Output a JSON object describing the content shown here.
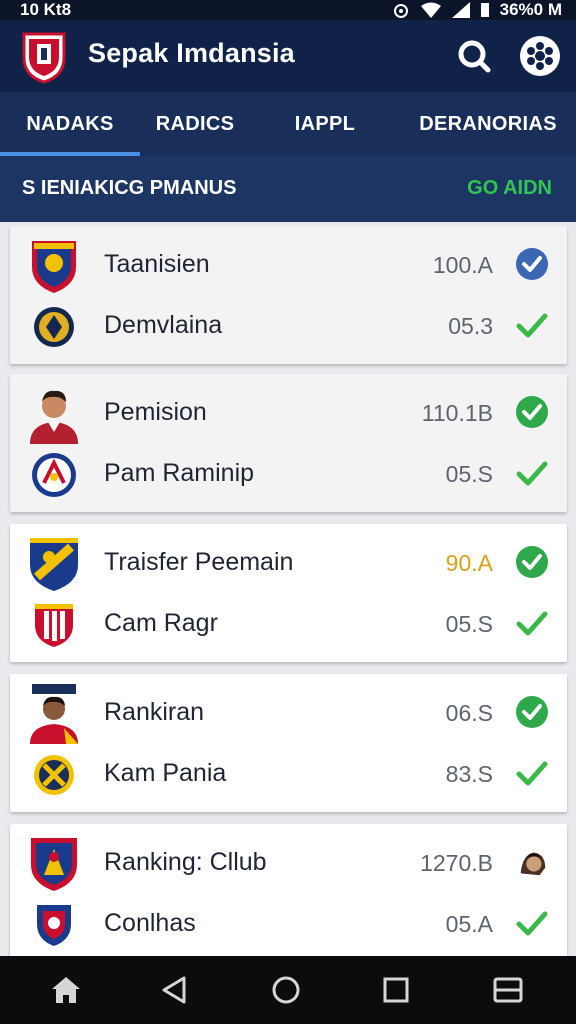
{
  "status_bar": {
    "left_text": "10  Kt8",
    "right_text": "36%0 M"
  },
  "app_bar": {
    "title": "Sepak Imdansia"
  },
  "tabs": [
    {
      "label": "NADAKS",
      "active": true
    },
    {
      "label": "RADICS",
      "active": false
    },
    {
      "label": "IAPPL",
      "active": false
    },
    {
      "label": "DERANORIAS",
      "active": false
    }
  ],
  "section": {
    "title": "S IENIAKICG PMANUS",
    "action": "GO AIDN"
  },
  "cards": [
    {
      "shade": "gray",
      "rows": [
        {
          "name": "Taanisien",
          "value": "100.A",
          "value_color": "gray",
          "badge": "shield-crest-icon",
          "status": "blue-check-circle-icon"
        },
        {
          "name": "Demvlaina",
          "value": "05.3",
          "value_color": "gray",
          "badge": "round-crest-icon",
          "status": "green-check-icon"
        }
      ]
    },
    {
      "shade": "gray",
      "rows": [
        {
          "name": "Pemision",
          "value": "110.1B",
          "value_color": "gray",
          "badge": "player-portrait-icon",
          "status": "green-check-circle-icon"
        },
        {
          "name": "Pam Raminip",
          "value": "05.S",
          "value_color": "gray",
          "badge": "round-crest-icon",
          "status": "green-check-icon"
        }
      ]
    },
    {
      "shade": "white",
      "rows": [
        {
          "name": "Traisfer Peemain",
          "value": "90.A",
          "value_color": "gold",
          "badge": "shield-crest-icon",
          "status": "green-check-circle-icon"
        },
        {
          "name": "Cam Ragr",
          "value": "05.S",
          "value_color": "gray",
          "badge": "shield-crest-icon",
          "status": "green-check-icon"
        }
      ]
    },
    {
      "shade": "white",
      "rows": [
        {
          "name": "Rankiran",
          "value": "06.S",
          "value_color": "gray",
          "badge": "player-portrait-icon",
          "status": "green-check-circle-icon"
        },
        {
          "name": "Kam Pania",
          "value": "83.S",
          "value_color": "gray",
          "badge": "round-crest-icon",
          "status": "green-check-icon"
        }
      ]
    },
    {
      "shade": "white",
      "rows": [
        {
          "name": "Ranking: Cllub",
          "value": "1270.B",
          "value_color": "gray",
          "badge": "shield-crest-icon",
          "status": "player-avatar-icon"
        },
        {
          "name": "Conlhas",
          "value": "05.A",
          "value_color": "gray",
          "badge": "shield-crest-icon",
          "status": "green-check-icon"
        }
      ]
    }
  ],
  "nav_bar": {
    "buttons": [
      "home-icon",
      "back-icon",
      "circle-home-icon",
      "recents-icon",
      "menu-icon"
    ]
  },
  "colors": {
    "app_bar": "#112248",
    "tabs": "#1a2e5a",
    "section": "#1d3563",
    "accent_green": "#2ea84a",
    "accent_blue": "#3a66b4",
    "gold": "#d9a21b"
  }
}
